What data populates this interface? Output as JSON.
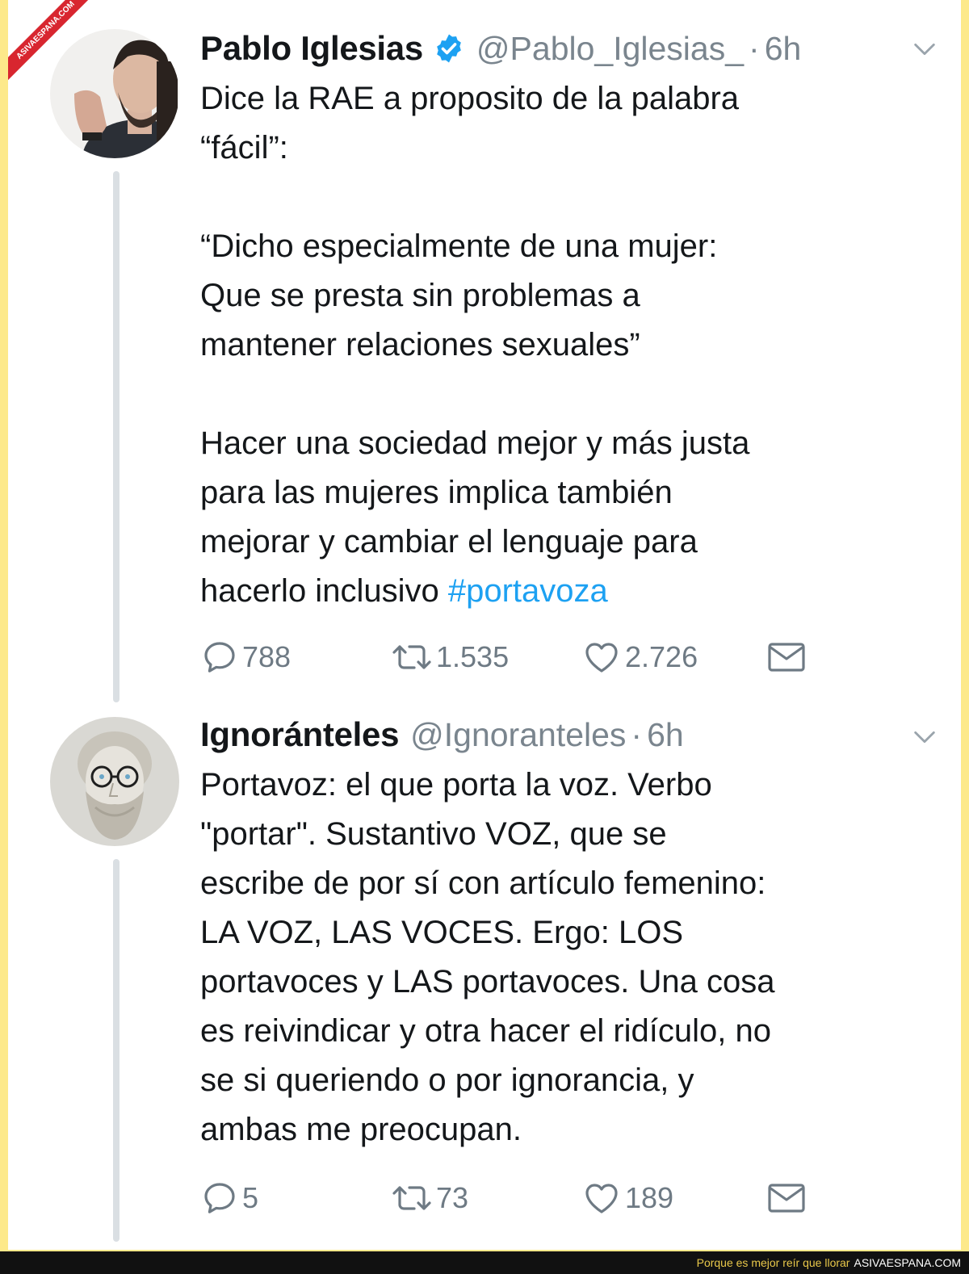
{
  "watermark": {
    "corner_text": "ASIVAESPANA.COM",
    "caption": "Porque es mejor reír que llorar",
    "site": "ASIVAESPANA.COM"
  },
  "tweets": [
    {
      "name": "Pablo Iglesias",
      "verified": true,
      "handle": "@Pablo_Iglesias_",
      "separator": "·",
      "time": "6h",
      "text_main": "Dice la RAE a proposito de la palabra\n“fácil”:\n\n“Dicho especialmente de una mujer:\nQue se presta sin problemas a\nmantener relaciones sexuales”\n\nHacer una sociedad mejor y más justa\npara las mujeres implica también\nmejorar y cambiar el lenguaje para\nhacerlo inclusivo ",
      "hashtag": "#portavoza",
      "replies": "788",
      "retweets": "1.535",
      "likes": "2.726"
    },
    {
      "name": "Ignoránteles",
      "verified": false,
      "handle": "@Ignoranteles",
      "separator": "·",
      "time": "6h",
      "text_main": "Portavoz: el que porta la voz. Verbo\n\"portar\". Sustantivo VOZ, que se\nescribe de por sí con artículo femenino:\nLA VOZ, LAS VOCES. Ergo: LOS\nportavoces y LAS portavoces. Una cosa\nes reivindicar y otra hacer el ridículo, no\nse si queriendo o por ignorancia, y\nambas me preocupan.",
      "replies": "5",
      "retweets": "73",
      "likes": "189"
    }
  ],
  "icons": {
    "reply": "reply-icon",
    "retweet": "retweet-icon",
    "like": "heart-icon",
    "dm": "mail-icon",
    "verified": "verified-badge-icon",
    "more": "chevron-down-icon"
  },
  "colors": {
    "page_border": "#fde98a",
    "hashtag": "#1da1f2",
    "verified": "#1da1f2",
    "secondary_text": "#7a858e",
    "thread_line": "#dadfe3",
    "footer_bar": "#111111",
    "footer_caption": "#e9c84a"
  }
}
